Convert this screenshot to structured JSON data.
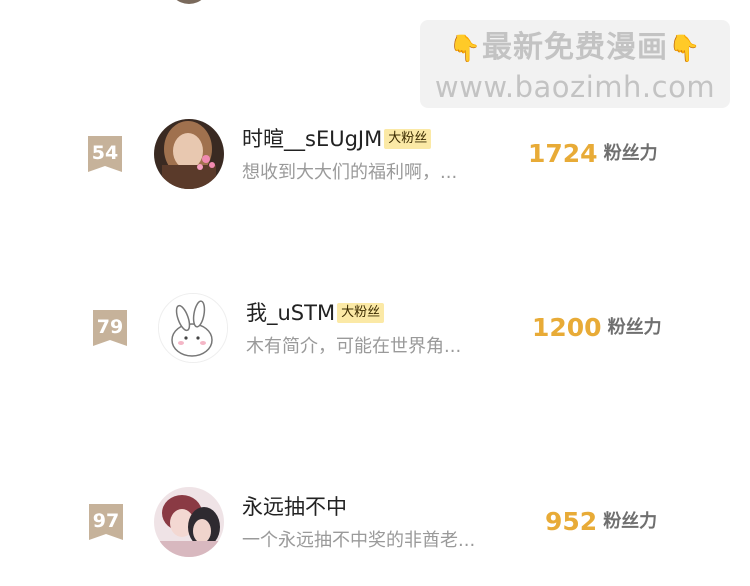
{
  "watermark": {
    "line1_left_icon": "pointing-down-hand-icon",
    "line1_text": "最新免费漫画",
    "line1_right_icon": "pointing-down-hand-icon",
    "line2_text": "www.baozimh.com"
  },
  "fans": [
    {
      "rank": "54",
      "username": "时暄__sEUgJM",
      "badge": "大粉丝",
      "bio": "想收到大大们的福利啊，...",
      "score": "1724",
      "score_label": "粉丝力",
      "avatar": "girl-portrait-avatar"
    },
    {
      "rank": "79",
      "username": "我_uSTM",
      "badge": "大粉丝",
      "bio": "木有简介，可能在世界角...",
      "score": "1200",
      "score_label": "粉丝力",
      "avatar": "bunny-doodle-avatar"
    },
    {
      "rank": "97",
      "username": "永远抽不中",
      "badge": "",
      "bio": "一个永远抽不中奖的非酋老...",
      "score": "952",
      "score_label": "粉丝力",
      "avatar": "anime-couple-avatar"
    }
  ],
  "colors": {
    "rank_badge": "#c6b29a",
    "score": "#e8ab37",
    "fan_badge_bg": "#fbe9a6"
  }
}
